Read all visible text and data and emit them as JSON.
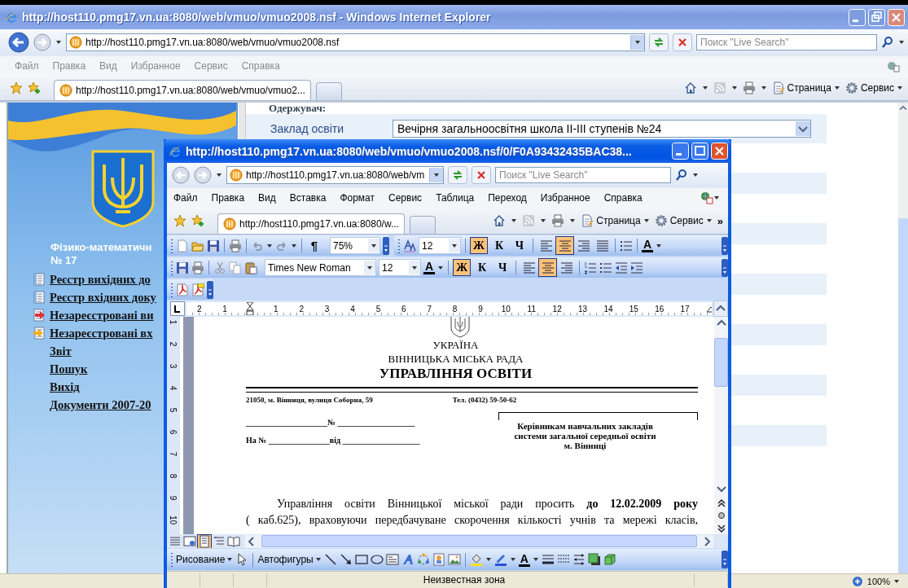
{
  "main_window": {
    "title": "http://host110.pmg17.vn.ua:8080/web/vmuo/vmuo2008.nsf - Windows Internet Explorer",
    "address": "http://host110.pmg17.vn.ua:8080/web/vmuo/vmuo2008.nsf",
    "search": {
      "placeholder": "Поиск \"Live Search\""
    },
    "menu": [
      "Файл",
      "Правка",
      "Вид",
      "Избранное",
      "Сервис",
      "Справка"
    ],
    "tabs": [
      {
        "label": "http://host110.pmg17.vn.ua:8080/web/vmuo/vmuo2...",
        "selected": true
      }
    ],
    "commands": [
      "Страница",
      "Сервис"
    ],
    "sidebar": {
      "school_name": [
        "Фізико-математичн",
        "№ 17"
      ],
      "links": [
        {
          "label": "Реєстр вихідних до",
          "kind": "register"
        },
        {
          "label": "Реєстр вхідних доку",
          "kind": "register"
        },
        {
          "label": "Незареєстровані ви",
          "kind": "outgoing"
        },
        {
          "label": "Незареєстровані вх",
          "kind": "incoming"
        },
        {
          "label": "Звіт",
          "kind": "plain"
        },
        {
          "label": "Пошук",
          "kind": "plain"
        },
        {
          "label": "Вихід",
          "kind": "plain"
        },
        {
          "label": "Документи 2007-20",
          "kind": "plain"
        }
      ]
    },
    "form": {
      "heading": "Одержувач:",
      "fields": [
        {
          "label": "Заклад освіти",
          "value": "Вечірня загальноосвітня школа ІІ-ІІІ ступенів №24"
        }
      ]
    },
    "status_bar": {
      "zoom": "100%"
    }
  },
  "popup_window": {
    "title": "http://host110.pmg17.vn.ua:8080/web/vmuo/vmuo2008.nsf/0/F0A93432435BAC38...",
    "address": "http://host110.pmg17.vn.ua:8080/web/vm",
    "search": {
      "placeholder": "Поиск \"Live Search\""
    },
    "menu": [
      "Файл",
      "Правка",
      "Вид",
      "Вставка",
      "Формат",
      "Сервис",
      "Таблица",
      "Переход",
      "Избранное",
      "Справка"
    ],
    "tabs": [
      {
        "label": "http://host110.pmg17.vn.ua:8080/w...",
        "selected": true
      }
    ],
    "commands": [
      "Страница",
      "Сервис"
    ],
    "more": "»",
    "formatting_toolbar": {
      "show_marks": "¶",
      "zoom": "75%",
      "font_size": "12",
      "styles": [
        {
          "label": "Ж",
          "on": true
        },
        {
          "label": "К",
          "on": false
        },
        {
          "label": "Ч",
          "on": false
        }
      ],
      "alignment": [
        {
          "selected": false
        },
        {
          "selected": true
        },
        {
          "selected": false
        },
        {
          "selected": false
        }
      ],
      "font_color": "A"
    },
    "standard_toolbar": {
      "font": "Times New Roman",
      "font_size": "12",
      "font_color": "A",
      "styles": [
        {
          "label": "Ж",
          "on": true
        },
        {
          "label": "К",
          "on": false
        },
        {
          "label": "Ч",
          "on": false
        }
      ],
      "alignment": [
        {
          "selected": false
        },
        {
          "selected": true
        },
        {
          "selected": false
        }
      ]
    },
    "ruler": {
      "left_ticks": [
        "2",
        "1"
      ],
      "right_ticks": [
        "1",
        "2",
        "3",
        "4",
        "5",
        "6",
        "7",
        "8",
        "9",
        "10",
        "11",
        "12",
        "13",
        "14",
        "15",
        "16",
        "17"
      ],
      "vertical_ticks": [
        "1",
        "2",
        "3",
        "4",
        "5",
        "6",
        "7",
        "8",
        "9",
        "10"
      ]
    },
    "document": {
      "header": [
        "УКРАЇНА",
        "ВІННИЦЬКА МІСЬКА РАДА",
        "УПРАВЛІННЯ ОСВІТИ"
      ],
      "address": "21050, м. Вінниця, вулиця Соборна, 59",
      "phone": "Тел. (0432) 59-50-62",
      "outgoing_number": "____________________№ ___________________",
      "reply_to": "На № _______________від ___________________",
      "addressee": "Керівникам навчальних закладів системи загальної середньої освіти м. Вінниці",
      "body": [
        "Управління освіти Вінницької міської ради  просить **до 12.02.2009 року**",
        "( каб.625),  враховуючи передбачуване скорочення кількості учнів та мережі класів,"
      ]
    },
    "views": [
      {
        "selected": false
      },
      {
        "selected": false
      },
      {
        "selected": true
      },
      {
        "selected": false
      },
      {
        "selected": false
      }
    ],
    "drawing_toolbar": {
      "draw": "Рисование",
      "autoshapes": "Автофигуры",
      "font_color": "A"
    },
    "status_bar": {
      "zone": "Неизвестная зона"
    }
  }
}
